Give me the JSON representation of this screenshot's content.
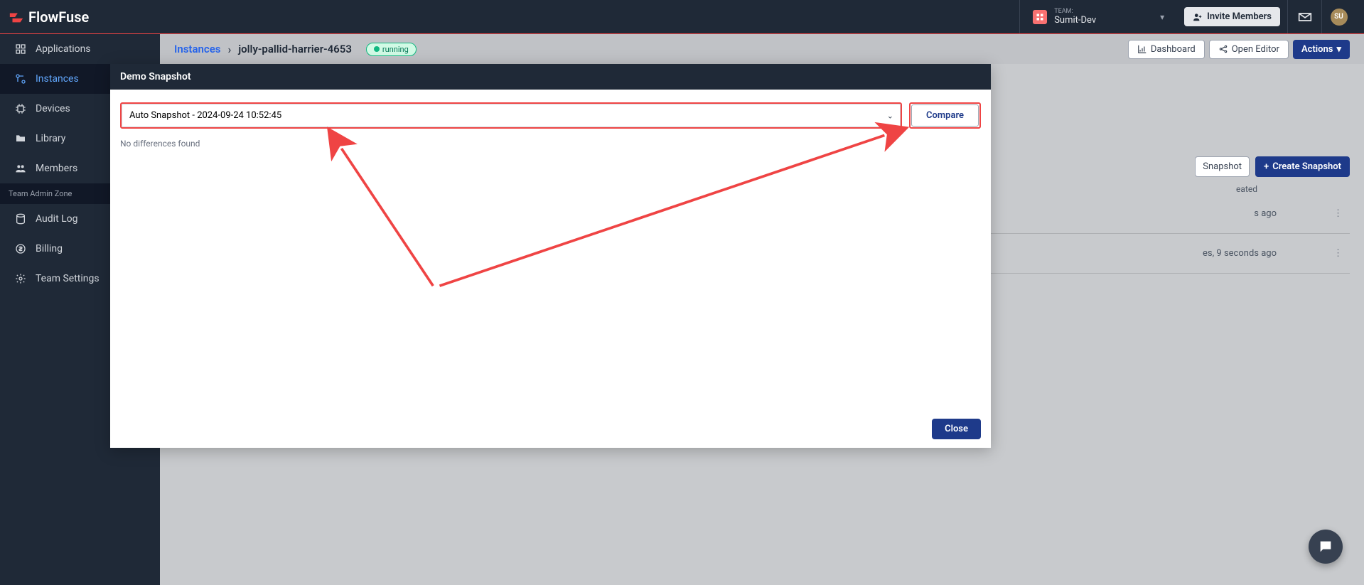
{
  "header": {
    "brand": "FlowFuse",
    "team_label": "TEAM:",
    "team_name": "Sumit-Dev",
    "invite_label": "Invite Members",
    "avatar_initials": "SU"
  },
  "sidebar": {
    "items": [
      {
        "label": "Applications"
      },
      {
        "label": "Instances"
      },
      {
        "label": "Devices"
      },
      {
        "label": "Library"
      },
      {
        "label": "Members"
      }
    ],
    "section_label": "Team Admin Zone",
    "admin_items": [
      {
        "label": "Audit Log"
      },
      {
        "label": "Billing"
      },
      {
        "label": "Team Settings"
      }
    ]
  },
  "breadcrumb": {
    "root": "Instances",
    "current": "jolly-pallid-harrier-4653",
    "status": "running",
    "dashboard_label": "Dashboard",
    "open_editor_label": "Open Editor",
    "actions_label": "Actions"
  },
  "bg": {
    "upload_snapshot_partial": "Snapshot",
    "create_snapshot_label": "Create Snapshot",
    "col_created_partial": "eated",
    "row1_time_partial": "s ago",
    "row2_time_partial": "es, 9 seconds ago"
  },
  "modal": {
    "title": "Demo Snapshot",
    "select_value": "Auto Snapshot - 2024-09-24 10:52:45",
    "compare_label": "Compare",
    "no_diff": "No differences found",
    "close_label": "Close"
  },
  "colors": {
    "primary": "#1e3a8a",
    "highlight": "#ef4444",
    "bg_dark": "#1f2937"
  }
}
